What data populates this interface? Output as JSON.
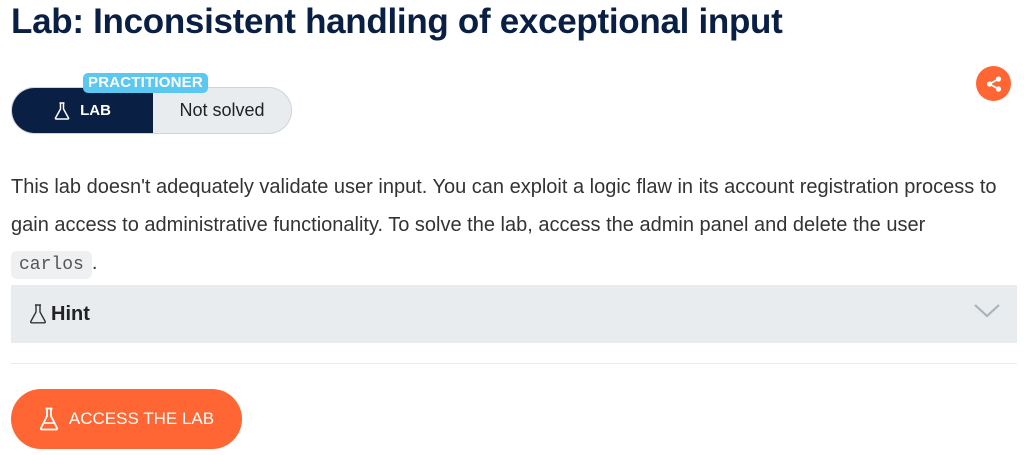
{
  "title": "Lab: Inconsistent handling of exceptional input",
  "badge": {
    "level": "PRACTITIONER"
  },
  "status": {
    "type_label": "LAB",
    "state": "Not solved"
  },
  "description": {
    "text_before": "This lab doesn't adequately validate user input. You can exploit a logic flaw in its account registration process to gain access to administrative functionality. To solve the lab, access the admin panel and delete the user ",
    "code": "carlos",
    "text_after": "."
  },
  "hint": {
    "label": "Hint"
  },
  "actions": {
    "access_label": "ACCESS THE LAB"
  },
  "icons": {
    "flask": "flask-icon",
    "share": "share-icon",
    "chevron": "chevron-down-icon"
  },
  "colors": {
    "accent": "#ff6633",
    "navy": "#0a1f44",
    "badge": "#5ac8f0",
    "panel": "#e8ecef"
  }
}
